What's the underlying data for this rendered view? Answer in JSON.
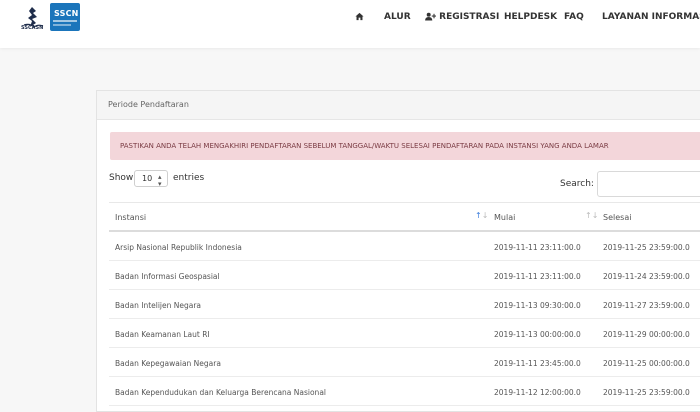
{
  "brand": {
    "sscasn_label": "SSCASN",
    "sscn_label": "SSCN"
  },
  "nav": {
    "items": [
      {
        "icon": "home-icon",
        "label": ""
      },
      {
        "label": "ALUR"
      },
      {
        "icon": "user-plus-icon",
        "label": "REGISTRASI"
      },
      {
        "label": "HELPDESK"
      },
      {
        "label": "FAQ"
      },
      {
        "label": "LAYANAN INFORMASI"
      }
    ]
  },
  "panel": {
    "title": "Periode Pendaftaran"
  },
  "alert": {
    "text": "PASTIKAN ANDA TELAH MENGAKHIRI PENDAFTARAN SEBELUM TANGGAL/WAKTU SELESAI PENDAFTARAN PADA INSTANSI YANG ANDA LAMAR"
  },
  "length_menu": {
    "show_label": "Show",
    "value": "10",
    "entries_label": "entries"
  },
  "search": {
    "label": "Search:",
    "value": ""
  },
  "table": {
    "columns": [
      "Instansi",
      "Mulai",
      "Selesai"
    ],
    "rows": [
      {
        "instansi": "Arsip Nasional Republik Indonesia",
        "mulai": "2019-11-11 23:11:00.0",
        "selesai": "2019-11-25 23:59:00.0"
      },
      {
        "instansi": "Badan Informasi Geospasial",
        "mulai": "2019-11-11 23:11:00.0",
        "selesai": "2019-11-24 23:59:00.0"
      },
      {
        "instansi": "Badan Intelijen Negara",
        "mulai": "2019-11-13 09:30:00.0",
        "selesai": "2019-11-27 23:59:00.0"
      },
      {
        "instansi": "Badan Keamanan Laut RI",
        "mulai": "2019-11-13 00:00:00.0",
        "selesai": "2019-11-29 00:00:00.0"
      },
      {
        "instansi": "Badan Kepegawaian Negara",
        "mulai": "2019-11-11 23:45:00.0",
        "selesai": "2019-11-25 00:00:00.0"
      },
      {
        "instansi": "Badan Kependudukan dan Keluarga Berencana Nasional",
        "mulai": "2019-11-12 12:00:00.0",
        "selesai": "2019-11-25 23:59:00.0"
      }
    ]
  },
  "colors": {
    "alert_bg": "#f3d6da",
    "logo_blue": "#1b75bb",
    "sort_active": "#3b7ddd"
  }
}
